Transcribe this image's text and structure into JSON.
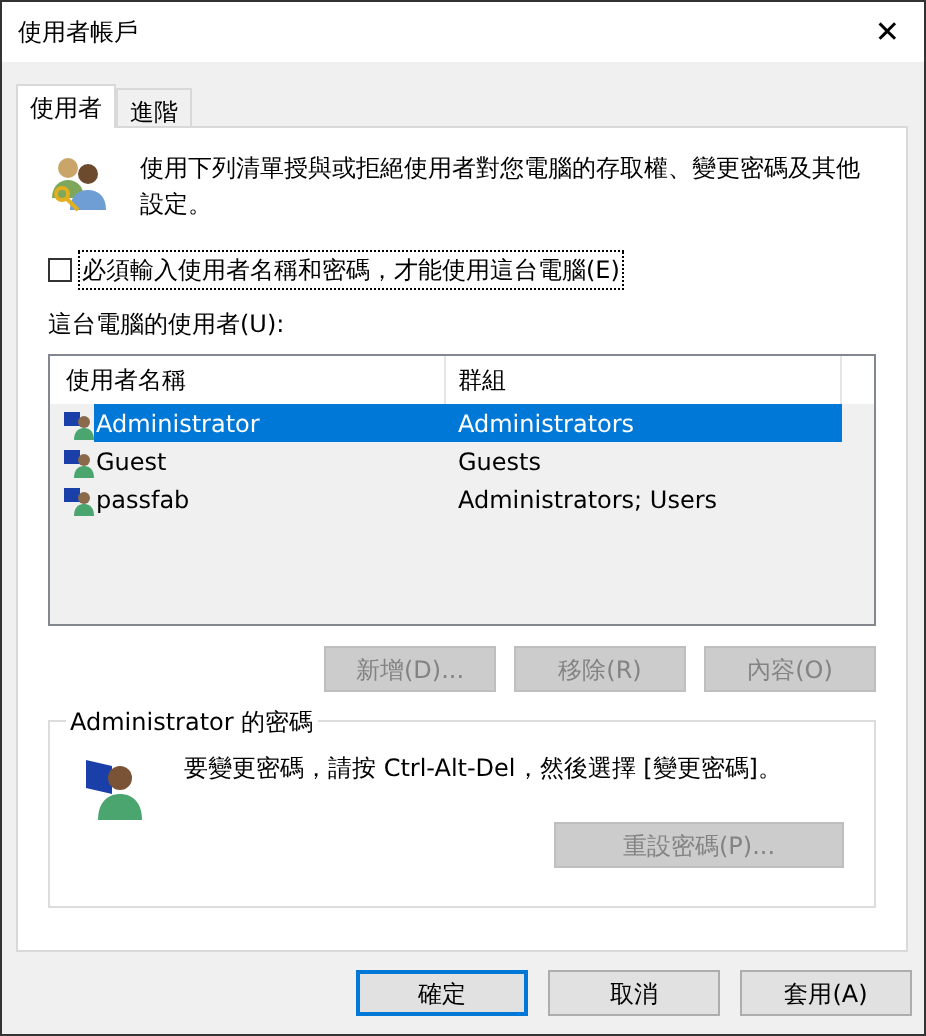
{
  "window": {
    "title": "使用者帳戶",
    "close": "✕"
  },
  "tabs": [
    {
      "label": "使用者",
      "selected": true
    },
    {
      "label": "進階",
      "selected": false
    }
  ],
  "intro": "使用下列清單授與或拒絕使用者對您電腦的存取權、變更密碼及其他設定。",
  "require_login": {
    "label": "必須輸入使用者名稱和密碼，才能使用這台電腦(E)",
    "checked": false
  },
  "users_label": "這台電腦的使用者(U):",
  "table": {
    "columns": [
      "使用者名稱",
      "群組"
    ],
    "rows": [
      {
        "name": "Administrator",
        "group": "Administrators",
        "selected": true
      },
      {
        "name": "Guest",
        "group": "Guests",
        "selected": false
      },
      {
        "name": "passfab",
        "group": "Administrators; Users",
        "selected": false
      }
    ]
  },
  "list_buttons": [
    {
      "label": "新增(D)...",
      "disabled": true
    },
    {
      "label": "移除(R)",
      "disabled": true
    },
    {
      "label": "內容(O)",
      "disabled": true
    }
  ],
  "password_group": {
    "title": "Administrator 的密碼",
    "text": "要變更密碼，請按 Ctrl-Alt-Del，然後選擇 [變更密碼]。",
    "button": {
      "label": "重設密碼(P)...",
      "disabled": true
    }
  },
  "dialog_buttons": [
    {
      "label": "確定",
      "default": true
    },
    {
      "label": "取消",
      "default": false
    },
    {
      "label": "套用(A)",
      "default": false
    }
  ]
}
